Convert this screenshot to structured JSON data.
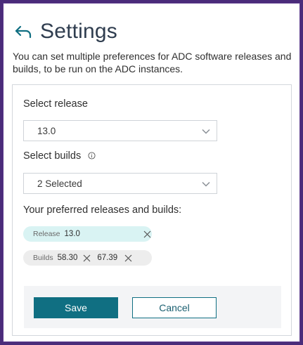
{
  "header": {
    "title": "Settings",
    "back_icon": "arrow-back-icon"
  },
  "description": "You can set multiple preferences for ADC software releases and builds, to be run on the ADC instances.",
  "form": {
    "release_label": "Select release",
    "release_value": "13.0",
    "builds_label": "Select builds",
    "builds_value": "2 Selected",
    "preferred_label": "Your preferred releases and builds:"
  },
  "chips": {
    "release": {
      "key": "Release",
      "value": "13.0"
    },
    "builds": {
      "key": "Builds",
      "values": [
        "58.30",
        "67.39"
      ]
    }
  },
  "buttons": {
    "save": "Save",
    "cancel": "Cancel"
  },
  "colors": {
    "primary": "#106f82",
    "frame": "#4a2c7a",
    "release_chip": "#d9f3f3",
    "builds_chip": "#ededed"
  }
}
